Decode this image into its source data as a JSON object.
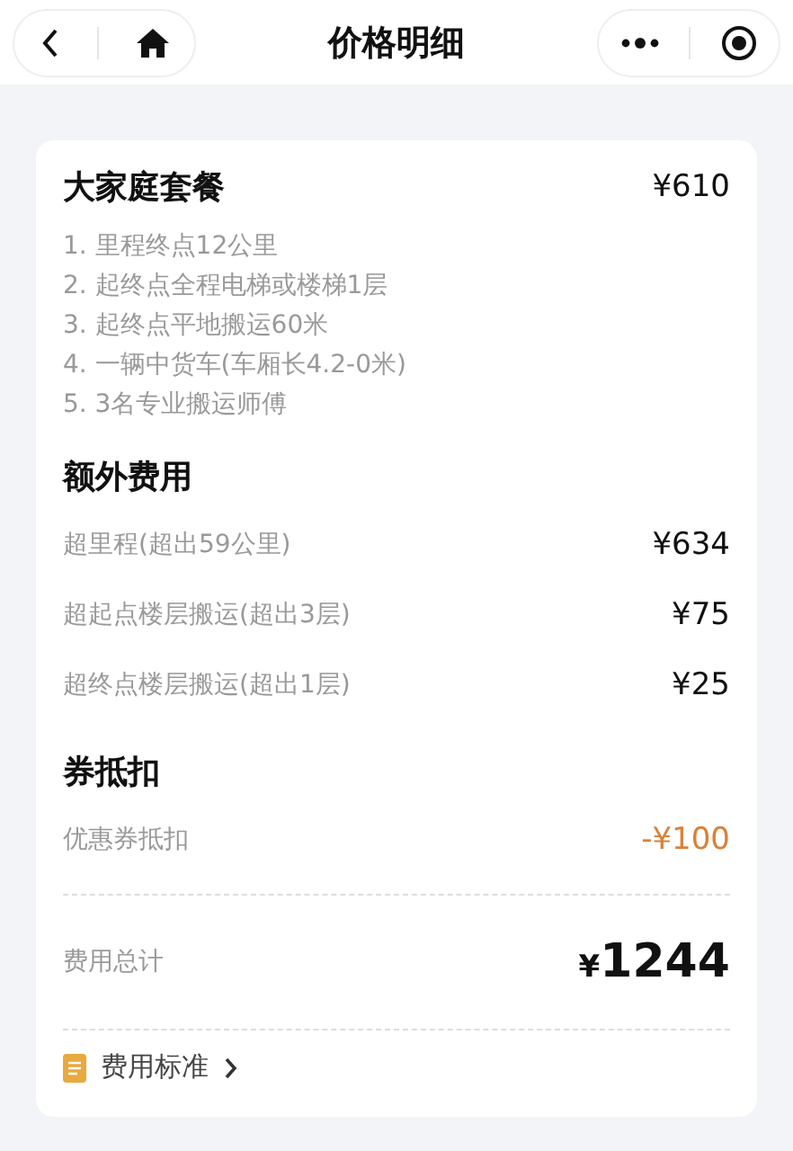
{
  "nav": {
    "title": "价格明细"
  },
  "package": {
    "name": "大家庭套餐",
    "price": "¥610",
    "items": [
      "1. 里程终点12公里",
      "2. 起终点全程电梯或楼梯1层",
      "3. 起终点平地搬运60米",
      "4. 一辆中货车(车厢长4.2-0米)",
      "5. 3名专业搬运师傅"
    ]
  },
  "sections": [
    {
      "title": "额外费用",
      "rows": [
        {
          "label": "超里程(超出59公里)",
          "amount": "¥634",
          "kind": "fee"
        },
        {
          "label": "超起点楼层搬运(超出3层)",
          "amount": "¥75",
          "kind": "fee"
        },
        {
          "label": "超终点楼层搬运(超出1层)",
          "amount": "¥25",
          "kind": "fee"
        }
      ]
    },
    {
      "title": "券抵扣",
      "rows": [
        {
          "label": "优惠券抵扣",
          "amount": "-¥100",
          "kind": "discount"
        }
      ]
    }
  ],
  "total": {
    "label": "费用总计",
    "currency": "¥",
    "amount": "1244"
  },
  "link": {
    "label": "费用标准"
  }
}
